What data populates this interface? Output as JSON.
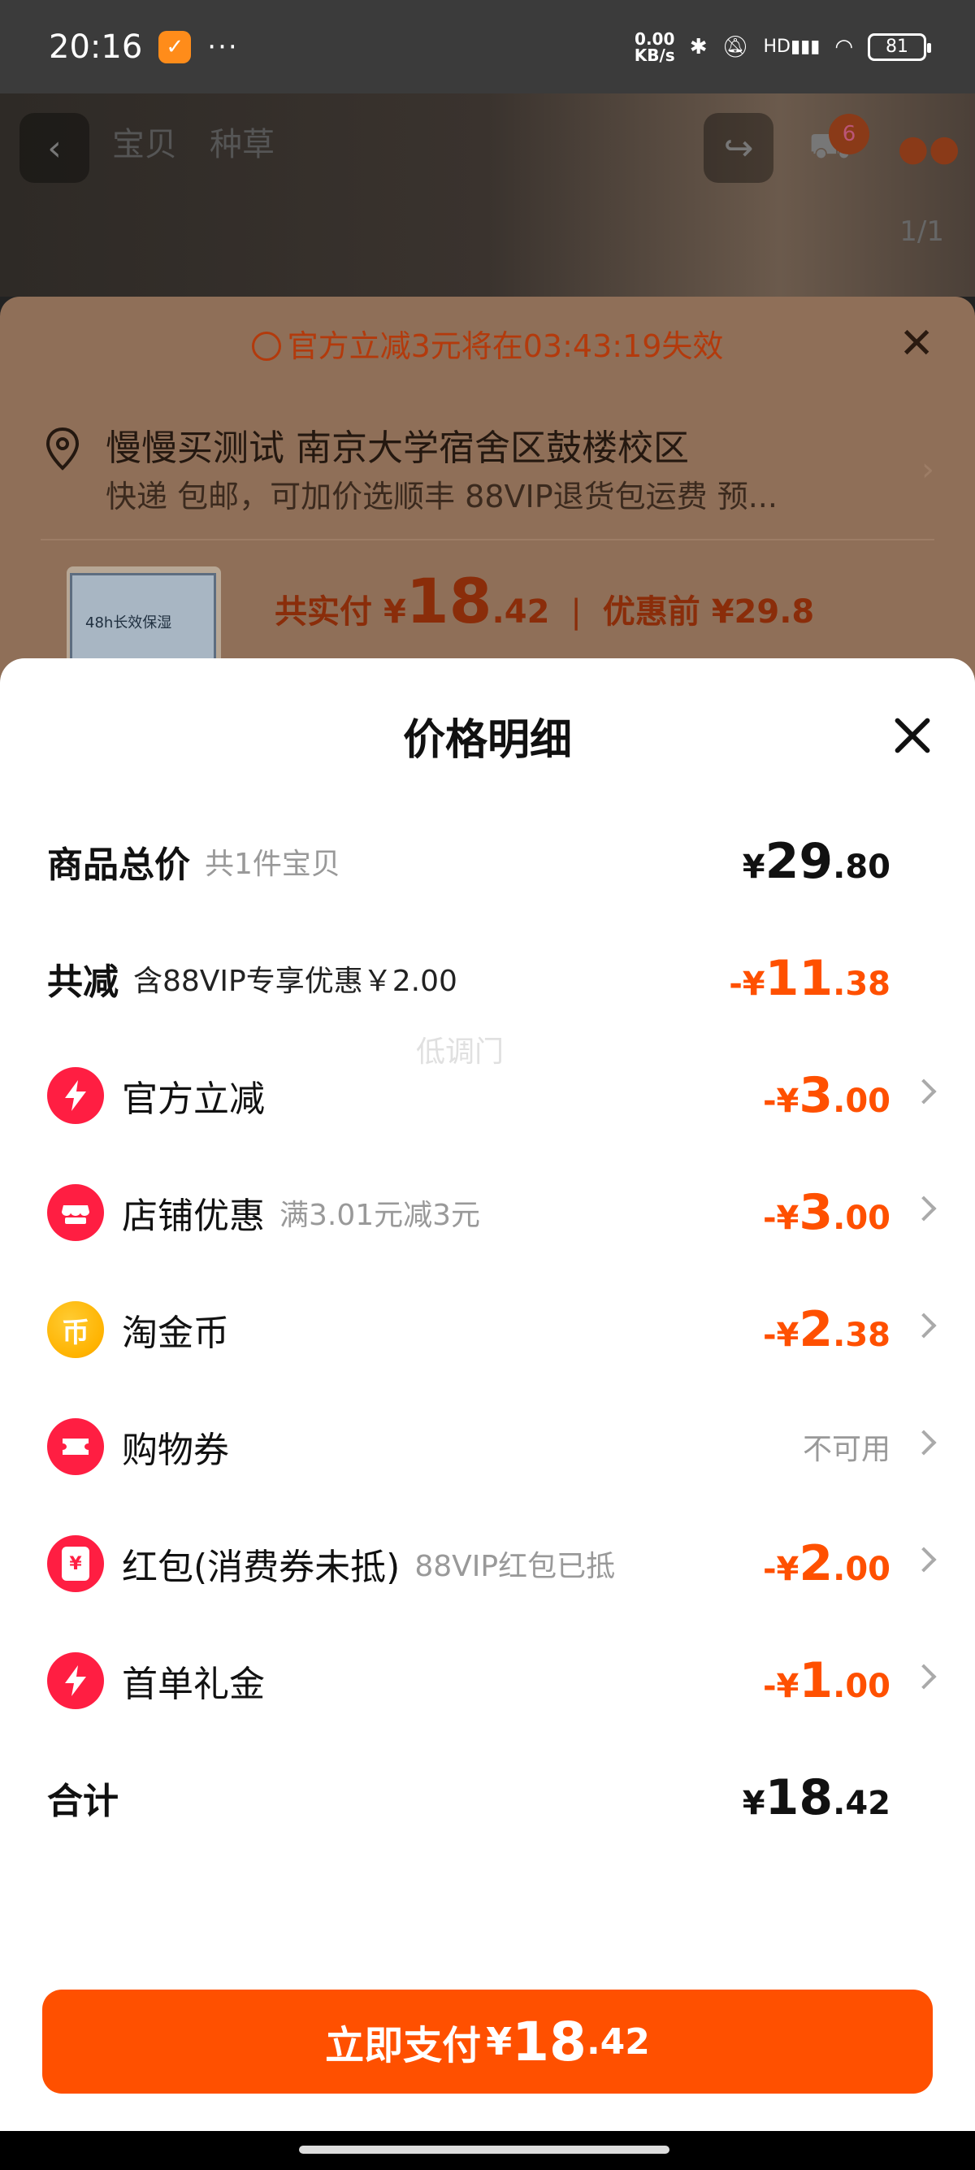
{
  "status_bar": {
    "time": "20:16",
    "dots": "···",
    "net_speed_value": "0.00",
    "net_speed_unit": "KB/s",
    "network": "HD",
    "battery": "81",
    "icons": [
      "bluetooth-icon",
      "mute-icon",
      "signal-icon",
      "wifi-icon",
      "battery-icon"
    ]
  },
  "background_page": {
    "tabs": [
      "宝贝",
      "种草"
    ],
    "cart_count": "6",
    "image_index": "1/1"
  },
  "middle_sheet": {
    "timer_text": "官方立减3元将在03:43:19失效",
    "address_name": "慢慢买测试 南京大学宿舍区鼓楼校区",
    "shipping_text": "快递 包邮，可加价选顺丰 88VIP退货包运费 预...",
    "product_text": "48h长效保湿",
    "pay_label": "共实付",
    "pay_currency": "¥",
    "pay_int": "18",
    "pay_dec": ".42",
    "before_label": "优惠前",
    "before_amount": "¥29.8"
  },
  "sheet": {
    "title": "价格明细",
    "watermark": "低调门",
    "rows": [
      {
        "label": "商品总价",
        "sub": "共1件宝贝",
        "cur": "¥",
        "int": "29",
        "dec": ".80"
      },
      {
        "label": "共减",
        "sub": "含88VIP专享优惠￥2.00",
        "cur": "-¥",
        "int": "11",
        "dec": ".38"
      },
      {
        "label": "官方立减",
        "sub": "",
        "cur": "-¥",
        "int": "3",
        "dec": ".00"
      },
      {
        "label": "店铺优惠",
        "sub": "满3.01元减3元",
        "cur": "-¥",
        "int": "3",
        "dec": ".00"
      },
      {
        "label": "淘金币",
        "sub": "",
        "cur": "-¥",
        "int": "2",
        "dec": ".38",
        "icon_char": "币"
      },
      {
        "label": "购物券",
        "sub": "",
        "status": "不可用"
      },
      {
        "label": "红包(消费券未抵)",
        "sub": "88VIP红包已抵",
        "cur": "-¥",
        "int": "2",
        "dec": ".00",
        "icon_char": "¥"
      },
      {
        "label": "首单礼金",
        "sub": "",
        "cur": "-¥",
        "int": "1",
        "dec": ".00"
      },
      {
        "label": "合计",
        "sub": "",
        "cur": "¥",
        "int": "18",
        "dec": ".42"
      }
    ]
  },
  "pay_button": {
    "label": "立即支付",
    "currency": "¥",
    "int": "18",
    "dec": ".42"
  },
  "colors": {
    "accent": "#ff5000",
    "icon_red": "#ff1e42",
    "coin_yellow": "#ffb300"
  }
}
